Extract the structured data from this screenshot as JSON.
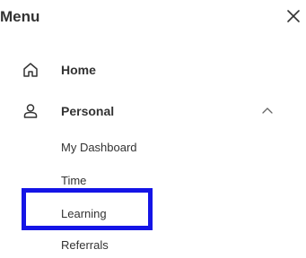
{
  "menu": {
    "title": "Menu",
    "close_icon": "close-icon"
  },
  "nav": {
    "home": {
      "label": "Home",
      "icon": "home-icon"
    },
    "personal": {
      "label": "Personal",
      "icon": "person-icon",
      "expanded": true,
      "chevron_icon": "chevron-up-icon",
      "sub_items": [
        "My Dashboard",
        "Time",
        "Learning",
        "Referrals"
      ]
    }
  },
  "annotation": {
    "highlighted_item": "Learning",
    "color": "#1414e6"
  }
}
